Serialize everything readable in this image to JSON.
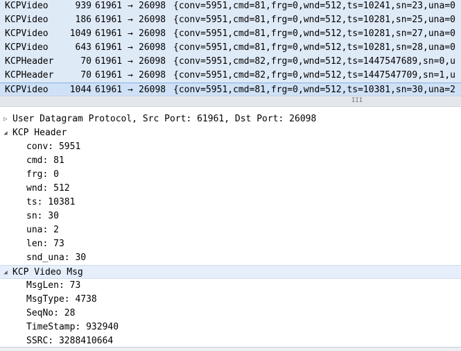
{
  "packet_list": {
    "arrow_glyph": "→",
    "rows": [
      {
        "protocol": "KCPVideo",
        "length": "939",
        "src_port": "61961",
        "dst_port": "26098",
        "info": "{conv=5951,cmd=81,frg=0,wnd=512,ts=10241,sn=23,una=0"
      },
      {
        "protocol": "KCPVideo",
        "length": "186",
        "src_port": "61961",
        "dst_port": "26098",
        "info": "{conv=5951,cmd=81,frg=0,wnd=512,ts=10281,sn=25,una=0"
      },
      {
        "protocol": "KCPVideo",
        "length": "1049",
        "src_port": "61961",
        "dst_port": "26098",
        "info": "{conv=5951,cmd=81,frg=0,wnd=512,ts=10281,sn=27,una=0"
      },
      {
        "protocol": "KCPVideo",
        "length": "643",
        "src_port": "61961",
        "dst_port": "26098",
        "info": "{conv=5951,cmd=81,frg=0,wnd=512,ts=10281,sn=28,una=0"
      },
      {
        "protocol": "KCPHeader",
        "length": "70",
        "src_port": "61961",
        "dst_port": "26098",
        "info": "{conv=5951,cmd=82,frg=0,wnd=512,ts=1447547689,sn=0,u"
      },
      {
        "protocol": "KCPHeader",
        "length": "70",
        "src_port": "61961",
        "dst_port": "26098",
        "info": "{conv=5951,cmd=82,frg=0,wnd=512,ts=1447547709,sn=1,u"
      },
      {
        "protocol": "KCPVideo",
        "length": "1044",
        "src_port": "61961",
        "dst_port": "26098",
        "info": "{conv=5951,cmd=81,frg=0,wnd=512,ts=10381,sn=30,una=2"
      }
    ],
    "selected_index": 6
  },
  "scrollbar": {
    "grip_glyph": "III"
  },
  "details": {
    "udp": {
      "toggle": "▷",
      "label": "User Datagram Protocol, Src Port: 61961, Dst Port: 26098",
      "expanded": false
    },
    "kcp_header": {
      "toggle": "◢",
      "label": "KCP Header",
      "expanded": true,
      "fields": [
        "conv: 5951",
        "cmd: 81",
        "frg: 0",
        "wnd: 512",
        "ts: 10381",
        "sn: 30",
        "una: 2",
        "len: 73",
        "snd_una: 30"
      ]
    },
    "kcp_video_msg": {
      "toggle": "◢",
      "label": "KCP Video Msg",
      "expanded": true,
      "selected": true,
      "fields": [
        "MsgLen: 73",
        "MsgType: 4738",
        "SeqNo: 28",
        "TimeStamp: 932940",
        "SSRC: 3288410664"
      ]
    }
  }
}
